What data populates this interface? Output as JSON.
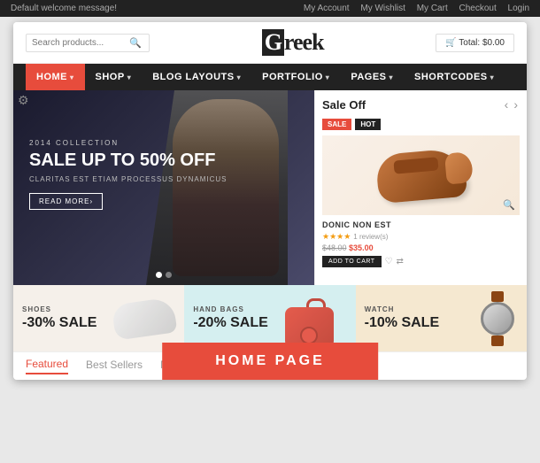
{
  "topbar": {
    "message": "Default welcome message!",
    "links": [
      "My Account",
      "My Wishlist",
      "My Cart",
      "Checkout",
      "Login"
    ]
  },
  "header": {
    "search_placeholder": "Search products...",
    "logo": "Greek",
    "logo_letter": "G",
    "cart_label": "🛒 Total: $0.00"
  },
  "nav": {
    "items": [
      {
        "label": "HOME",
        "active": true,
        "has_dropdown": false
      },
      {
        "label": "SHOP",
        "active": false,
        "has_dropdown": true
      },
      {
        "label": "BLOG LAYOUTS",
        "active": false,
        "has_dropdown": true
      },
      {
        "label": "PORTFOLIO",
        "active": false,
        "has_dropdown": true
      },
      {
        "label": "PAGES",
        "active": false,
        "has_dropdown": true
      },
      {
        "label": "SHORTCODES",
        "active": false,
        "has_dropdown": true
      }
    ]
  },
  "hero": {
    "sub_label": "2014 Collection",
    "title": "SALE UP TO 50% OFF",
    "description": "Claritas est etiam processus dynamicus",
    "button_label": "READ MORE›"
  },
  "sale_off": {
    "title": "Sale Off",
    "product": {
      "badge_sale": "SALE",
      "badge_hot": "HOT",
      "name": "DONIC NON EST",
      "stars": "★★★★",
      "reviews": "1 review(s)",
      "old_price": "$48.00",
      "new_price": "$35.00",
      "add_to_cart": "Add To Cart"
    }
  },
  "promos": [
    {
      "category": "SHOES",
      "discount": "-30% SALE",
      "bg": "#f5f0ea"
    },
    {
      "category": "HAND BAGS",
      "discount": "-20% SALE",
      "bg": "#d5eff0"
    },
    {
      "category": "WATCH",
      "discount": "-10% SALE",
      "bg": "#f5e8d0"
    }
  ],
  "tabs": [
    {
      "label": "Featured",
      "active": true
    },
    {
      "label": "Best Sellers",
      "active": false
    },
    {
      "label": "New Products",
      "active": false
    }
  ],
  "homepage_btn": "HOME PAGE"
}
